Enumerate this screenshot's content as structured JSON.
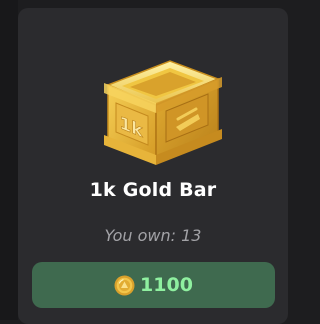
{
  "item": {
    "name": "1k Gold Bar",
    "badge_text": "1k",
    "owned_text": "You own: 13",
    "price": "1100",
    "icon": "gold-crate-icon"
  },
  "colors": {
    "card_background": "#2b2b2e",
    "button_background": "#3f6a4f",
    "price_text": "#8ff0a0",
    "owned_text": "#a2a2a6"
  }
}
